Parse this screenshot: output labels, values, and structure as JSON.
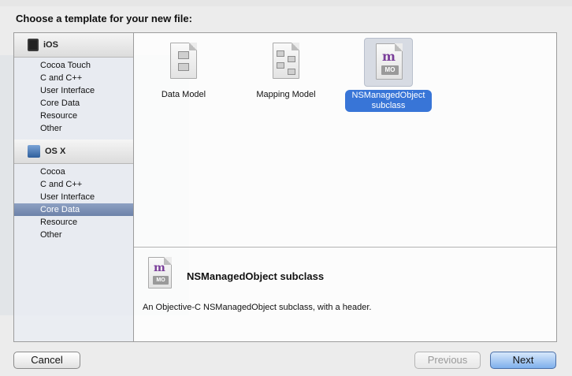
{
  "window": {
    "title": "Choose a template for your new file:"
  },
  "sidebar": {
    "groups": [
      {
        "label": "iOS",
        "icon": "iphone-icon",
        "items": [
          "Cocoa Touch",
          "C and C++",
          "User Interface",
          "Core Data",
          "Resource",
          "Other"
        ]
      },
      {
        "label": "OS X",
        "icon": "mac-finder-icon",
        "items": [
          "Cocoa",
          "C and C++",
          "User Interface",
          "Core Data",
          "Resource",
          "Other"
        ]
      }
    ],
    "selected": "OS X / Core Data"
  },
  "templates": [
    {
      "label": "Data Model",
      "icon": "data-model-document-icon"
    },
    {
      "label": "Mapping Model",
      "icon": "mapping-model-document-icon"
    },
    {
      "label": "NSManagedObject subclass",
      "icon": "managed-object-document-icon",
      "selected": true
    }
  ],
  "detail": {
    "title": "NSManagedObject subclass",
    "description": "An Objective-C NSManagedObject subclass, with a header.",
    "icon": "managed-object-document-icon",
    "icon_letter": "m",
    "icon_tag": "MO"
  },
  "buttons": {
    "cancel": "Cancel",
    "previous": "Previous",
    "next": "Next"
  },
  "colors": {
    "selection_blue": "#3875d7",
    "sidebar_selection": "#7a8fb4",
    "next_button": "#7fb0ec"
  }
}
